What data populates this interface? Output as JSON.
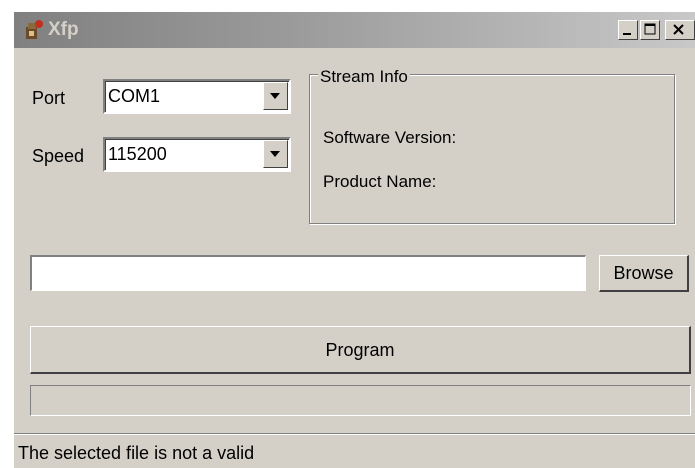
{
  "window": {
    "title": "Xfp",
    "app_icon": "xfp-app-icon",
    "controls": [
      "minimize-icon",
      "maximize-icon",
      "close-icon"
    ]
  },
  "port": {
    "label": "Port",
    "selected": "COM1"
  },
  "speed": {
    "label": "Speed",
    "selected": "115200"
  },
  "stream_info": {
    "title": "Stream Info",
    "software_version_label": "Software Version:",
    "product_name_label": "Product Name:"
  },
  "file": {
    "value": "",
    "placeholder": ""
  },
  "buttons": {
    "browse": "Browse",
    "program": "Program"
  },
  "progress": {
    "value": 0
  },
  "status": {
    "text": "The selected file is not a valid"
  },
  "colors": {
    "face": "#d4d0c8",
    "title_inactive": "#808080"
  }
}
